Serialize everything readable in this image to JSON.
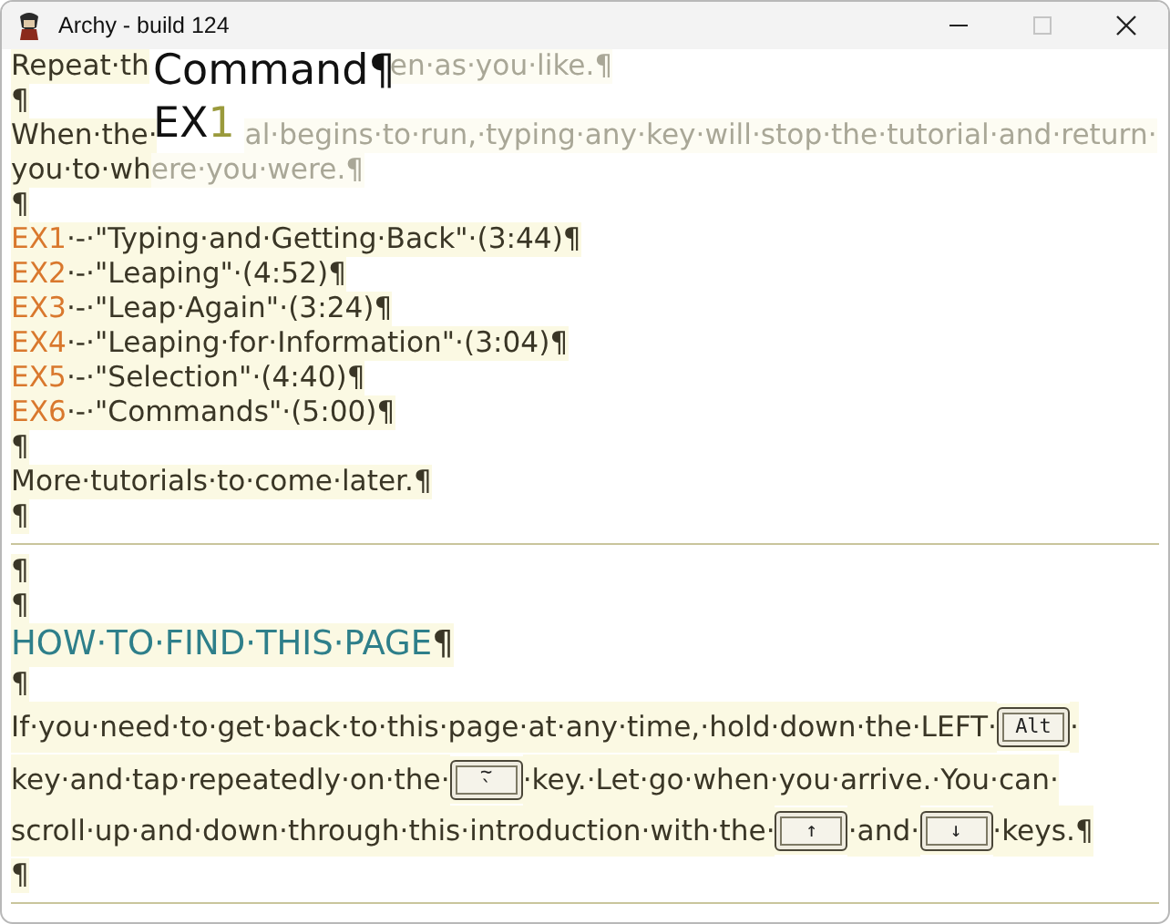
{
  "window": {
    "title": "Archy - build 124",
    "maximize_disabled": true
  },
  "lines": [
    {
      "kind": "text",
      "parts": [
        {
          "kind": "text",
          "t": "Repeat·th",
          "dimmed": false
        },
        {
          "kind": "text",
          "t": "en·as·you·like.¶",
          "dimmed": true
        }
      ]
    },
    {
      "kind": "text",
      "parts": [
        {
          "kind": "text",
          "t": "¶",
          "dimmed": false
        }
      ]
    },
    {
      "kind": "text",
      "parts": [
        {
          "kind": "text",
          "t": "When·the·",
          "dimmed": false
        },
        {
          "kind": "text",
          "t": "al·begins·to·run,·typing·any·key·will·stop·the·tutorial·and·return·",
          "dimmed": true
        }
      ]
    },
    {
      "kind": "text",
      "parts": [
        {
          "kind": "text",
          "t": "you·to·wh",
          "dimmed": false
        },
        {
          "kind": "text",
          "t": "ere·you·were.¶",
          "dimmed": true
        }
      ]
    },
    {
      "kind": "text",
      "parts": [
        {
          "kind": "text",
          "t": "¶",
          "dimmed": false
        }
      ]
    },
    {
      "kind": "text",
      "parts": [
        {
          "kind": "label",
          "t": "EX1"
        },
        {
          "kind": "text",
          "t": "·-·\"Typing·and·Getting·Back\"·(3:44)¶",
          "dimmed": false
        }
      ]
    },
    {
      "kind": "text",
      "parts": [
        {
          "kind": "label",
          "t": "EX2"
        },
        {
          "kind": "text",
          "t": "·-·\"Leaping\"·(4:52)¶",
          "dimmed": false
        }
      ]
    },
    {
      "kind": "text",
      "parts": [
        {
          "kind": "label",
          "t": "EX3"
        },
        {
          "kind": "text",
          "t": "·-·\"Leap·Again\"·(3:24)¶",
          "dimmed": false
        }
      ]
    },
    {
      "kind": "text",
      "parts": [
        {
          "kind": "label",
          "t": "EX4"
        },
        {
          "kind": "text",
          "t": "·-·\"Leaping·for·Information\"·(3:04)¶",
          "dimmed": false
        }
      ]
    },
    {
      "kind": "text",
      "parts": [
        {
          "kind": "label",
          "t": "EX5"
        },
        {
          "kind": "text",
          "t": "·-·\"Selection\"·(4:40)¶",
          "dimmed": false
        }
      ]
    },
    {
      "kind": "text",
      "parts": [
        {
          "kind": "label",
          "t": "EX6"
        },
        {
          "kind": "text",
          "t": "·-·\"Commands\"·(5:00)¶",
          "dimmed": false
        }
      ]
    },
    {
      "kind": "text",
      "parts": [
        {
          "kind": "text",
          "t": "¶",
          "dimmed": false
        }
      ]
    },
    {
      "kind": "text",
      "parts": [
        {
          "kind": "text",
          "t": "More·tutorials·to·come·later.¶",
          "dimmed": false
        }
      ]
    },
    {
      "kind": "text",
      "parts": [
        {
          "kind": "text",
          "t": "¶",
          "dimmed": false
        }
      ]
    },
    {
      "kind": "rule"
    },
    {
      "kind": "text",
      "parts": [
        {
          "kind": "text",
          "t": "¶",
          "dimmed": false
        }
      ]
    },
    {
      "kind": "text",
      "parts": [
        {
          "kind": "text",
          "t": "¶",
          "dimmed": false
        }
      ]
    },
    {
      "kind": "heading",
      "parts": [
        {
          "kind": "heading",
          "t": "HOW·TO·FIND·THIS·PAGE"
        },
        {
          "kind": "text",
          "t": "¶",
          "dimmed": false
        }
      ]
    },
    {
      "kind": "text",
      "parts": [
        {
          "kind": "text",
          "t": "¶",
          "dimmed": false
        }
      ]
    },
    {
      "kind": "keys",
      "parts": [
        {
          "kind": "text",
          "t": "If·you·need·to·get·back·to·this·page·at·any·time,·hold·down·the·LEFT·",
          "dimmed": false
        },
        {
          "kind": "key",
          "label": "Alt"
        },
        {
          "kind": "text",
          "t": "·",
          "dimmed": false
        }
      ]
    },
    {
      "kind": "keys",
      "parts": [
        {
          "kind": "text",
          "t": "key·and·tap·repeatedly·on·the·",
          "dimmed": false
        },
        {
          "kind": "key",
          "label": "~",
          "lower": "`"
        },
        {
          "kind": "text",
          "t": "·key.·Let·go·when·you·arrive.·You·can·",
          "dimmed": false
        }
      ]
    },
    {
      "kind": "keys",
      "parts": [
        {
          "kind": "text",
          "t": "scroll·up·and·down·through·this·introduction·with·the·",
          "dimmed": false
        },
        {
          "kind": "key",
          "label": "↑"
        },
        {
          "kind": "text",
          "t": "·and·",
          "dimmed": false
        },
        {
          "kind": "key",
          "label": "↓"
        },
        {
          "kind": "text",
          "t": "·keys.¶",
          "dimmed": false
        }
      ]
    },
    {
      "kind": "text",
      "parts": [
        {
          "kind": "text",
          "t": "¶",
          "dimmed": false
        }
      ]
    },
    {
      "kind": "rule"
    }
  ],
  "leap_popup": {
    "command": "Command¶",
    "query": "EX",
    "query_tail": "1"
  }
}
